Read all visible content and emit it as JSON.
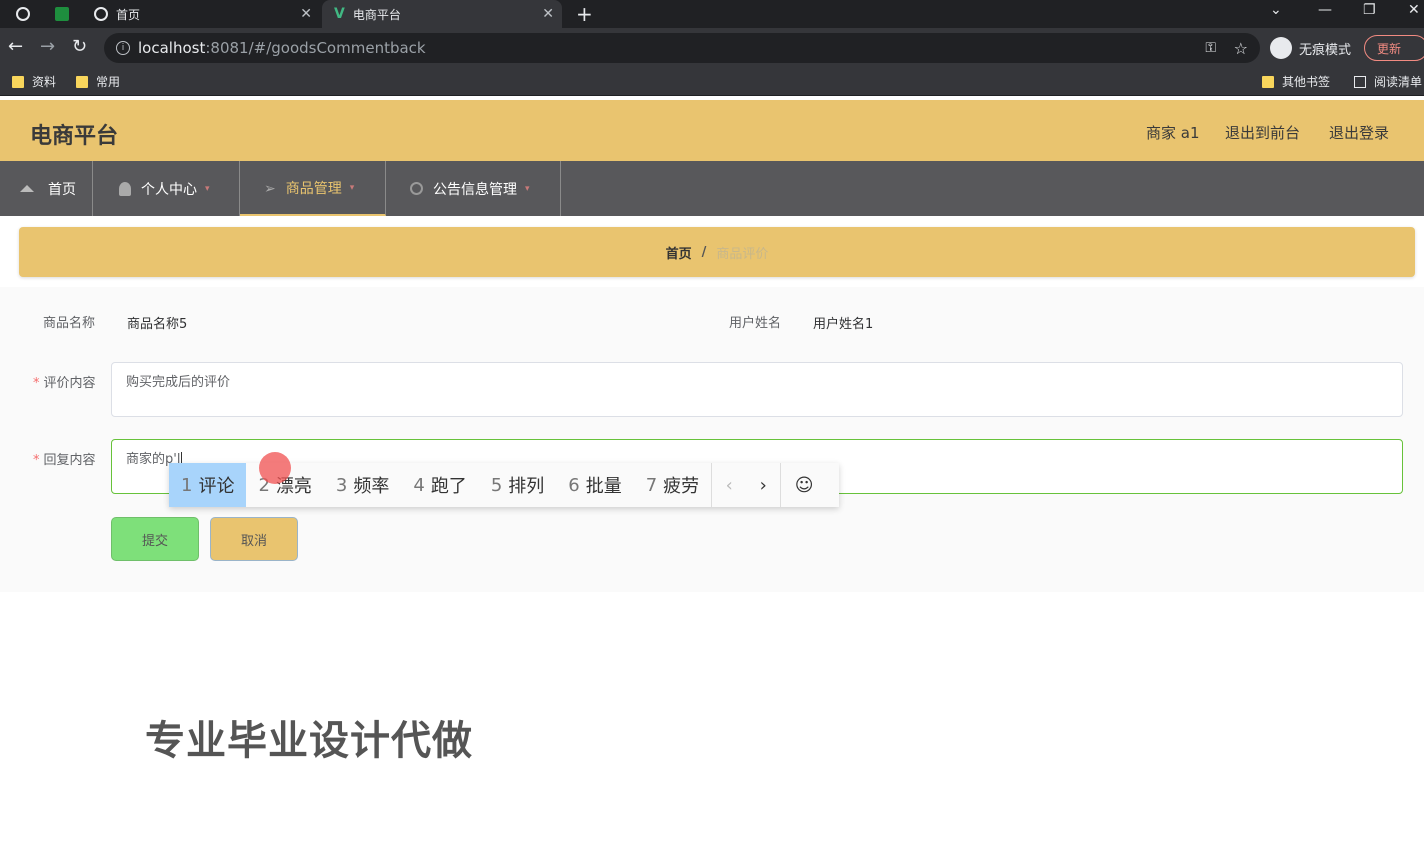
{
  "browser": {
    "tabs": [
      {
        "title": "首页",
        "icon": "globe-icon"
      },
      {
        "title": "电商平台",
        "icon": "vue-logo-icon"
      }
    ],
    "new_tab": "+",
    "url_host": "localhost",
    "url_path": ":8081/#/goodsCommentback",
    "incognito_label": "无痕模式",
    "update_label": "更新",
    "bookmarks": [
      "资料",
      "常用"
    ],
    "bookmarks_right": [
      "其他书签",
      "阅读清单"
    ]
  },
  "header": {
    "logo": "电商平台",
    "user": "商家 a1",
    "to_front": "退出到前台",
    "logout": "退出登录"
  },
  "nav": {
    "items": [
      {
        "label": "首页",
        "icon": "home-icon"
      },
      {
        "label": "个人中心",
        "icon": "user-icon"
      },
      {
        "label": "商品管理",
        "icon": "send-icon"
      },
      {
        "label": "公告信息管理",
        "icon": "power-icon"
      }
    ]
  },
  "breadcrumb": {
    "home": "首页",
    "separator": "/",
    "current": "商品评价"
  },
  "form": {
    "goods_name_label": "商品名称",
    "goods_name_value": "商品名称5",
    "user_name_label": "用户姓名",
    "user_name_value": "用户姓名1",
    "comment_label": "评价内容",
    "comment_value": "购买完成后的评价",
    "reply_label": "回复内容",
    "reply_value": "商家的p'l",
    "submit_label": "提交",
    "cancel_label": "取消"
  },
  "ime": {
    "candidates": [
      {
        "n": "1",
        "text": "评论"
      },
      {
        "n": "2",
        "text": "漂亮"
      },
      {
        "n": "3",
        "text": "频率"
      },
      {
        "n": "4",
        "text": "跑了"
      },
      {
        "n": "5",
        "text": "排列"
      },
      {
        "n": "6",
        "text": "批量"
      },
      {
        "n": "7",
        "text": "疲劳"
      }
    ]
  },
  "watermark": "专业毕业设计代做",
  "colors": {
    "accent": "#e9c46f",
    "nav_bg": "#58585b",
    "submit": "#7ee07a"
  }
}
